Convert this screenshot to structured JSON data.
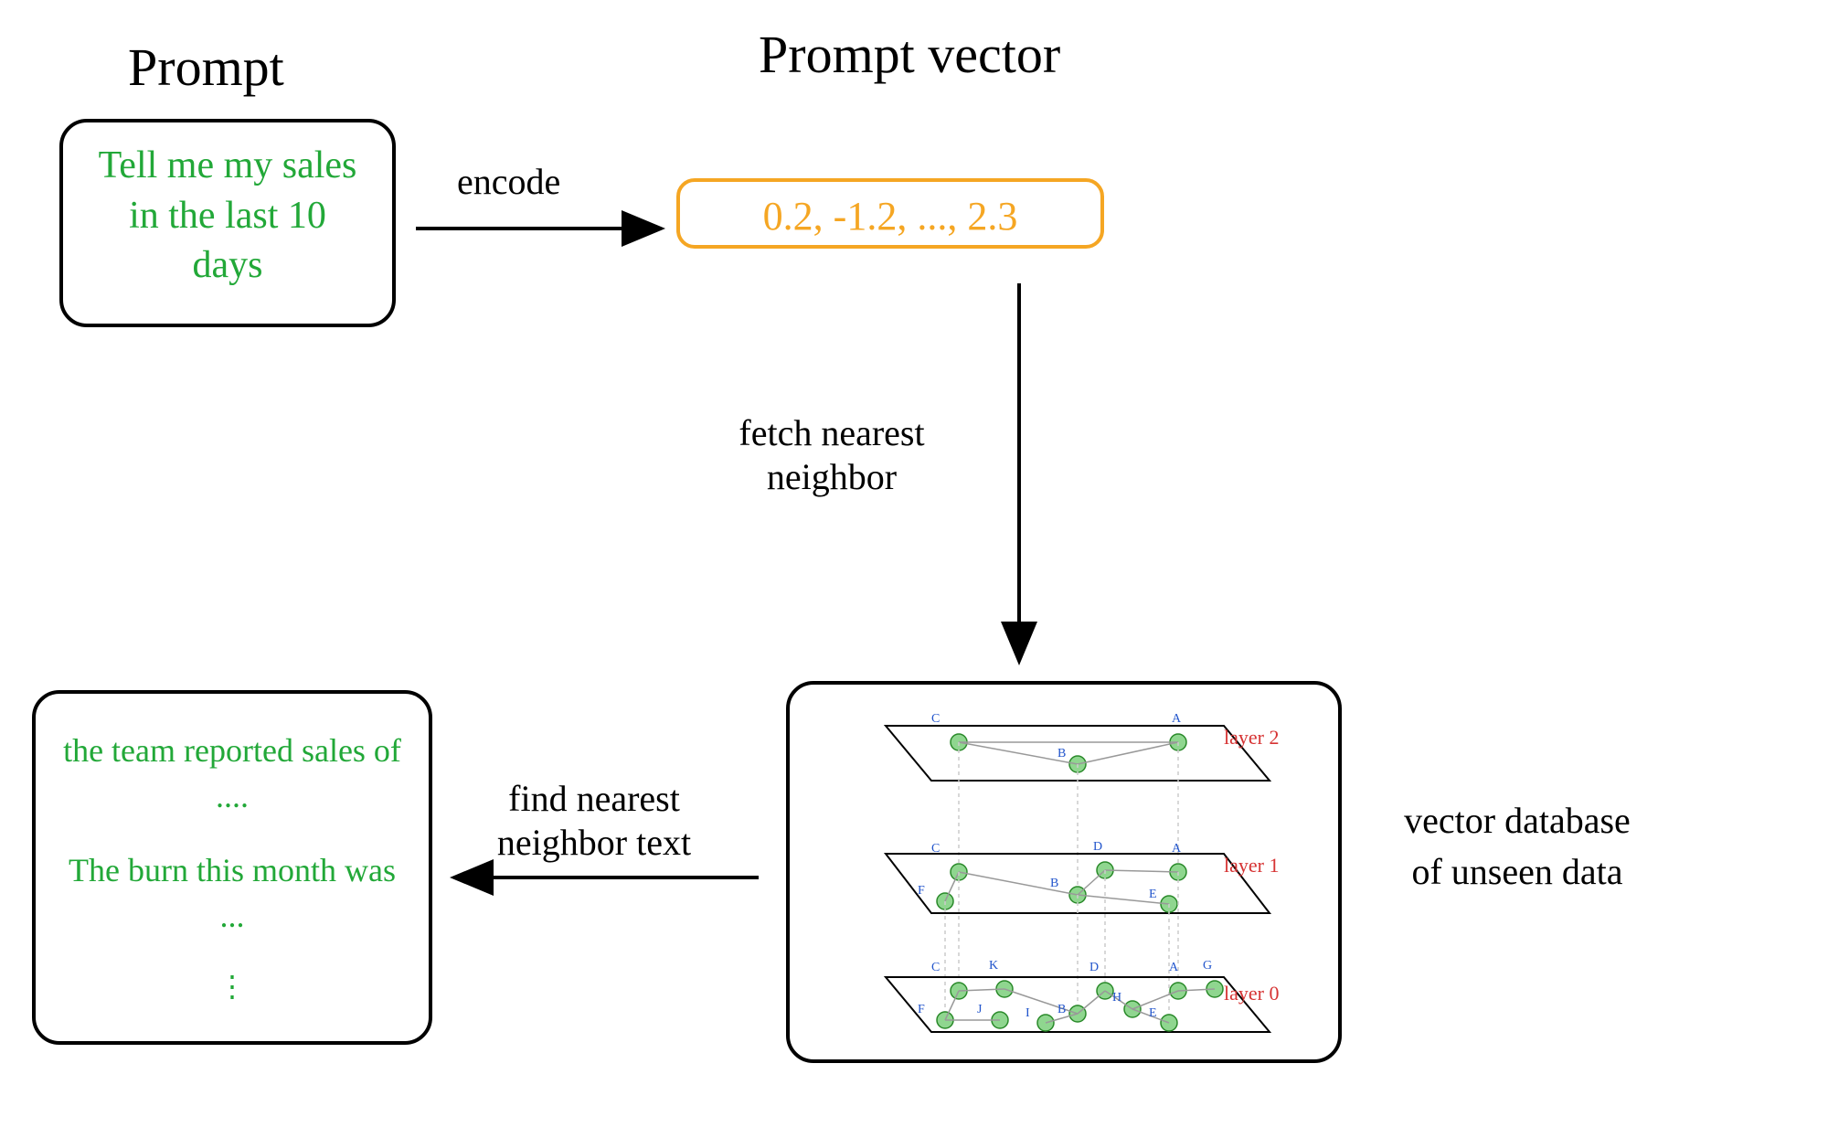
{
  "titles": {
    "prompt": "Prompt",
    "vector": "Prompt vector"
  },
  "boxes": {
    "prompt_text": "Tell me my sales in the last 10 days",
    "vector_text": "0.2, -1.2, ..., 2.3",
    "result_line1": "the team reported sales of ....",
    "result_line2": "The burn this month was ...",
    "result_dots": "⋮"
  },
  "arrows": {
    "encode": "encode",
    "fetch": "fetch nearest neighbor",
    "find": "find nearest neighbor text"
  },
  "db": {
    "label": "vector database of unseen data",
    "layers": {
      "layer0": "layer 0",
      "layer1": "layer 1",
      "layer2": "layer 2"
    },
    "nodes": {
      "a": "A",
      "b": "B",
      "c": "C",
      "d": "D",
      "e": "E",
      "f": "F",
      "g": "G",
      "h": "H",
      "i": "I",
      "j": "J",
      "k": "K"
    }
  }
}
